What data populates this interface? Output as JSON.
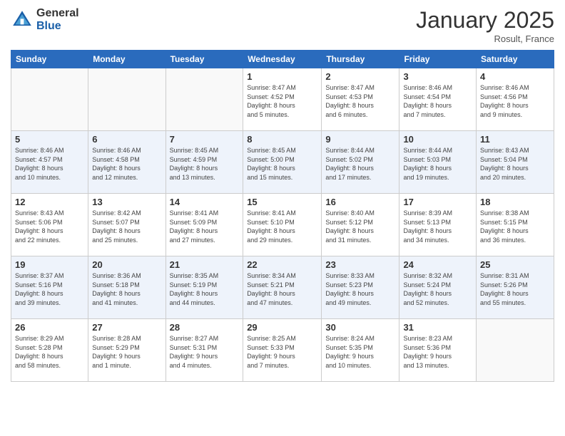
{
  "header": {
    "logo_general": "General",
    "logo_blue": "Blue",
    "month_title": "January 2025",
    "location": "Rosult, France"
  },
  "weekdays": [
    "Sunday",
    "Monday",
    "Tuesday",
    "Wednesday",
    "Thursday",
    "Friday",
    "Saturday"
  ],
  "weeks": [
    [
      {
        "day": "",
        "info": ""
      },
      {
        "day": "",
        "info": ""
      },
      {
        "day": "",
        "info": ""
      },
      {
        "day": "1",
        "info": "Sunrise: 8:47 AM\nSunset: 4:52 PM\nDaylight: 8 hours\nand 5 minutes."
      },
      {
        "day": "2",
        "info": "Sunrise: 8:47 AM\nSunset: 4:53 PM\nDaylight: 8 hours\nand 6 minutes."
      },
      {
        "day": "3",
        "info": "Sunrise: 8:46 AM\nSunset: 4:54 PM\nDaylight: 8 hours\nand 7 minutes."
      },
      {
        "day": "4",
        "info": "Sunrise: 8:46 AM\nSunset: 4:56 PM\nDaylight: 8 hours\nand 9 minutes."
      }
    ],
    [
      {
        "day": "5",
        "info": "Sunrise: 8:46 AM\nSunset: 4:57 PM\nDaylight: 8 hours\nand 10 minutes."
      },
      {
        "day": "6",
        "info": "Sunrise: 8:46 AM\nSunset: 4:58 PM\nDaylight: 8 hours\nand 12 minutes."
      },
      {
        "day": "7",
        "info": "Sunrise: 8:45 AM\nSunset: 4:59 PM\nDaylight: 8 hours\nand 13 minutes."
      },
      {
        "day": "8",
        "info": "Sunrise: 8:45 AM\nSunset: 5:00 PM\nDaylight: 8 hours\nand 15 minutes."
      },
      {
        "day": "9",
        "info": "Sunrise: 8:44 AM\nSunset: 5:02 PM\nDaylight: 8 hours\nand 17 minutes."
      },
      {
        "day": "10",
        "info": "Sunrise: 8:44 AM\nSunset: 5:03 PM\nDaylight: 8 hours\nand 19 minutes."
      },
      {
        "day": "11",
        "info": "Sunrise: 8:43 AM\nSunset: 5:04 PM\nDaylight: 8 hours\nand 20 minutes."
      }
    ],
    [
      {
        "day": "12",
        "info": "Sunrise: 8:43 AM\nSunset: 5:06 PM\nDaylight: 8 hours\nand 22 minutes."
      },
      {
        "day": "13",
        "info": "Sunrise: 8:42 AM\nSunset: 5:07 PM\nDaylight: 8 hours\nand 25 minutes."
      },
      {
        "day": "14",
        "info": "Sunrise: 8:41 AM\nSunset: 5:09 PM\nDaylight: 8 hours\nand 27 minutes."
      },
      {
        "day": "15",
        "info": "Sunrise: 8:41 AM\nSunset: 5:10 PM\nDaylight: 8 hours\nand 29 minutes."
      },
      {
        "day": "16",
        "info": "Sunrise: 8:40 AM\nSunset: 5:12 PM\nDaylight: 8 hours\nand 31 minutes."
      },
      {
        "day": "17",
        "info": "Sunrise: 8:39 AM\nSunset: 5:13 PM\nDaylight: 8 hours\nand 34 minutes."
      },
      {
        "day": "18",
        "info": "Sunrise: 8:38 AM\nSunset: 5:15 PM\nDaylight: 8 hours\nand 36 minutes."
      }
    ],
    [
      {
        "day": "19",
        "info": "Sunrise: 8:37 AM\nSunset: 5:16 PM\nDaylight: 8 hours\nand 39 minutes."
      },
      {
        "day": "20",
        "info": "Sunrise: 8:36 AM\nSunset: 5:18 PM\nDaylight: 8 hours\nand 41 minutes."
      },
      {
        "day": "21",
        "info": "Sunrise: 8:35 AM\nSunset: 5:19 PM\nDaylight: 8 hours\nand 44 minutes."
      },
      {
        "day": "22",
        "info": "Sunrise: 8:34 AM\nSunset: 5:21 PM\nDaylight: 8 hours\nand 47 minutes."
      },
      {
        "day": "23",
        "info": "Sunrise: 8:33 AM\nSunset: 5:23 PM\nDaylight: 8 hours\nand 49 minutes."
      },
      {
        "day": "24",
        "info": "Sunrise: 8:32 AM\nSunset: 5:24 PM\nDaylight: 8 hours\nand 52 minutes."
      },
      {
        "day": "25",
        "info": "Sunrise: 8:31 AM\nSunset: 5:26 PM\nDaylight: 8 hours\nand 55 minutes."
      }
    ],
    [
      {
        "day": "26",
        "info": "Sunrise: 8:29 AM\nSunset: 5:28 PM\nDaylight: 8 hours\nand 58 minutes."
      },
      {
        "day": "27",
        "info": "Sunrise: 8:28 AM\nSunset: 5:29 PM\nDaylight: 9 hours\nand 1 minute."
      },
      {
        "day": "28",
        "info": "Sunrise: 8:27 AM\nSunset: 5:31 PM\nDaylight: 9 hours\nand 4 minutes."
      },
      {
        "day": "29",
        "info": "Sunrise: 8:25 AM\nSunset: 5:33 PM\nDaylight: 9 hours\nand 7 minutes."
      },
      {
        "day": "30",
        "info": "Sunrise: 8:24 AM\nSunset: 5:35 PM\nDaylight: 9 hours\nand 10 minutes."
      },
      {
        "day": "31",
        "info": "Sunrise: 8:23 AM\nSunset: 5:36 PM\nDaylight: 9 hours\nand 13 minutes."
      },
      {
        "day": "",
        "info": ""
      }
    ]
  ]
}
